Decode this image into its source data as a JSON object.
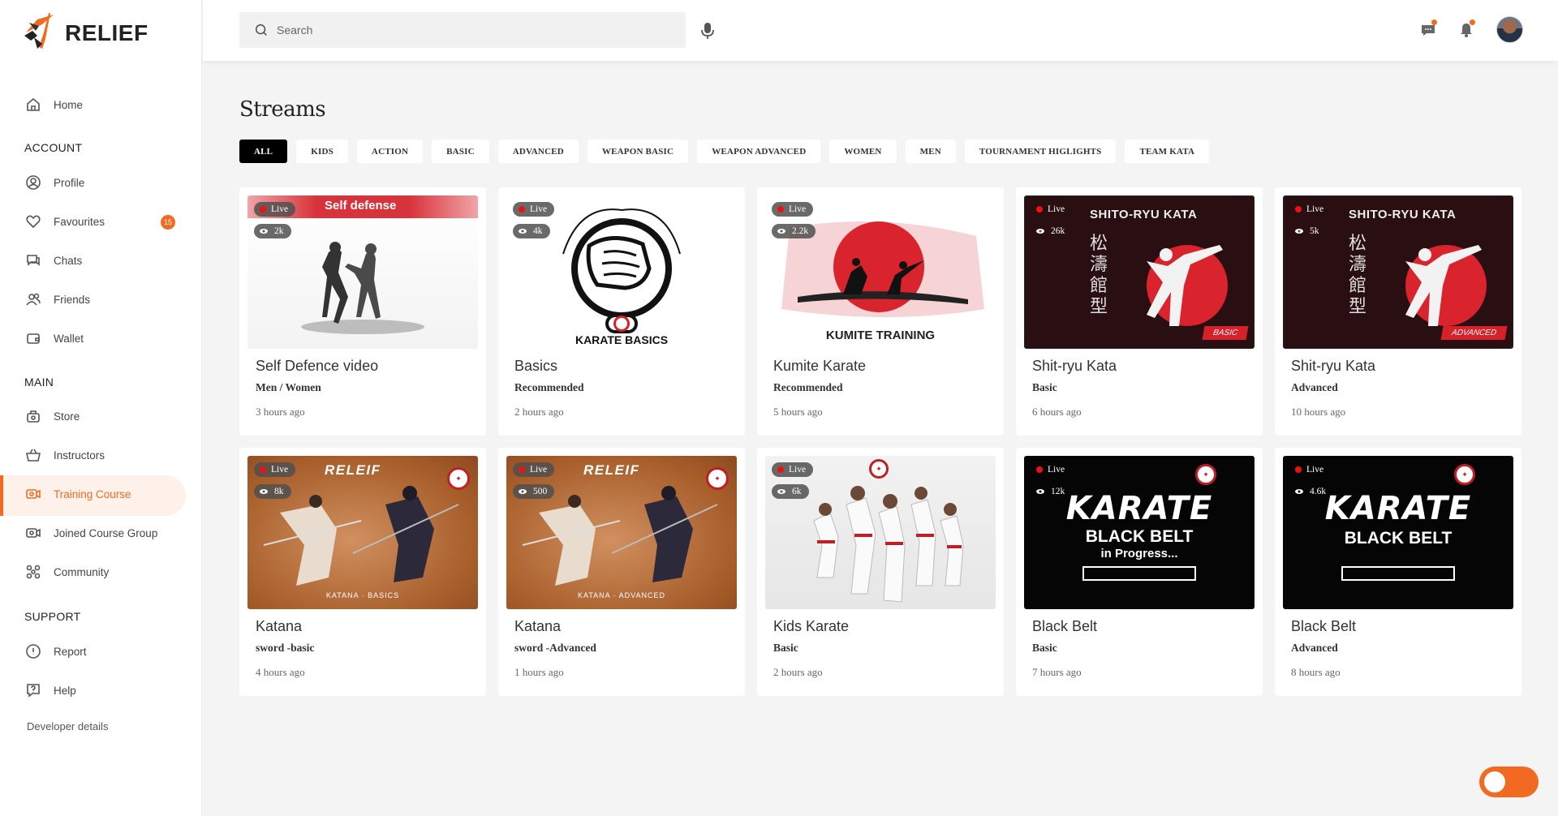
{
  "app": {
    "logo_text": "RELIEF"
  },
  "search": {
    "placeholder": "Search"
  },
  "sidebar": {
    "items": [
      {
        "label": "Home",
        "icon": "home-icon"
      },
      {
        "label": "Profile",
        "icon": "user-icon"
      },
      {
        "label": "Favourites",
        "icon": "heart-icon",
        "badge": "15"
      },
      {
        "label": "Chats",
        "icon": "chat-icon"
      },
      {
        "label": "Friends",
        "icon": "users-icon"
      },
      {
        "label": "Wallet",
        "icon": "wallet-icon"
      },
      {
        "label": "Store",
        "icon": "store-icon"
      },
      {
        "label": "Instructors",
        "icon": "basket-icon"
      },
      {
        "label": "Training Course",
        "icon": "video-icon",
        "active": true
      },
      {
        "label": "Joined Course Group",
        "icon": "video-group-icon"
      },
      {
        "label": "Community",
        "icon": "community-icon"
      },
      {
        "label": "Report",
        "icon": "alert-icon"
      },
      {
        "label": "Help",
        "icon": "help-icon"
      }
    ],
    "sections": {
      "account": "ACCOUNT",
      "main": "MAIN",
      "support": "SUPPORT"
    },
    "developer": "Developer details"
  },
  "main": {
    "title": "Streams",
    "filters": [
      "ALL",
      "KIDS",
      "ACTION",
      "BASIC",
      "ADVANCED",
      "WEAPON BASIC",
      "WEAPON ADVANCED",
      "WOMEN",
      "MEN",
      "TOURNAMENT HIGLIGHTS",
      "TEAM KATA"
    ],
    "live_label": "Live",
    "cards": [
      {
        "title": "Self Defence video",
        "subtitle": "Men / Women",
        "time": "3 hours ago",
        "views": "2k",
        "thumb_text": "Self defense"
      },
      {
        "title": "Basics",
        "subtitle": "Recommended",
        "time": "2 hours ago",
        "views": "4k",
        "thumb_text": "KARATE BASICS"
      },
      {
        "title": "Kumite Karate",
        "subtitle": "Recommended",
        "time": "5 hours ago",
        "views": "2.2k",
        "thumb_text": "KUMITE TRAINING"
      },
      {
        "title": "Shit-ryu Kata",
        "subtitle": "Basic",
        "time": "6 hours ago",
        "views": "26k",
        "thumb_text": "SHITO-RYU KATA",
        "thumb_tag": "BASIC"
      },
      {
        "title": "Shit-ryu Kata",
        "subtitle": "Advanced",
        "time": "10 hours ago",
        "views": "5k",
        "thumb_text": "SHITO-RYU KATA",
        "thumb_tag": "ADVANCED"
      },
      {
        "title": "Katana",
        "subtitle": "sword -basic",
        "time": "4 hours ago",
        "views": "8k",
        "thumb_text": "RELEIF",
        "thumb_sub": "KATANA · BASICS"
      },
      {
        "title": "Katana",
        "subtitle": "sword -Advanced",
        "time": "1 hours ago",
        "views": "500",
        "thumb_text": "RELEIF",
        "thumb_sub": "KATANA · ADVANCED"
      },
      {
        "title": "Kids Karate",
        "subtitle": "Basic",
        "time": "2 hours ago",
        "views": "6k"
      },
      {
        "title": "Black Belt",
        "subtitle": "Basic",
        "time": "7 hours ago",
        "views": "12k",
        "thumb_text": "KARATE",
        "thumb_text2": "BLACK BELT",
        "thumb_text3": "in Progress..."
      },
      {
        "title": "Black Belt",
        "subtitle": "Advanced",
        "time": "8 hours ago",
        "views": "4.6k",
        "thumb_text": "KARATE",
        "thumb_text2": "BLACK BELT"
      }
    ]
  },
  "colors": {
    "accent": "#f26a21",
    "live": "#e11111"
  }
}
